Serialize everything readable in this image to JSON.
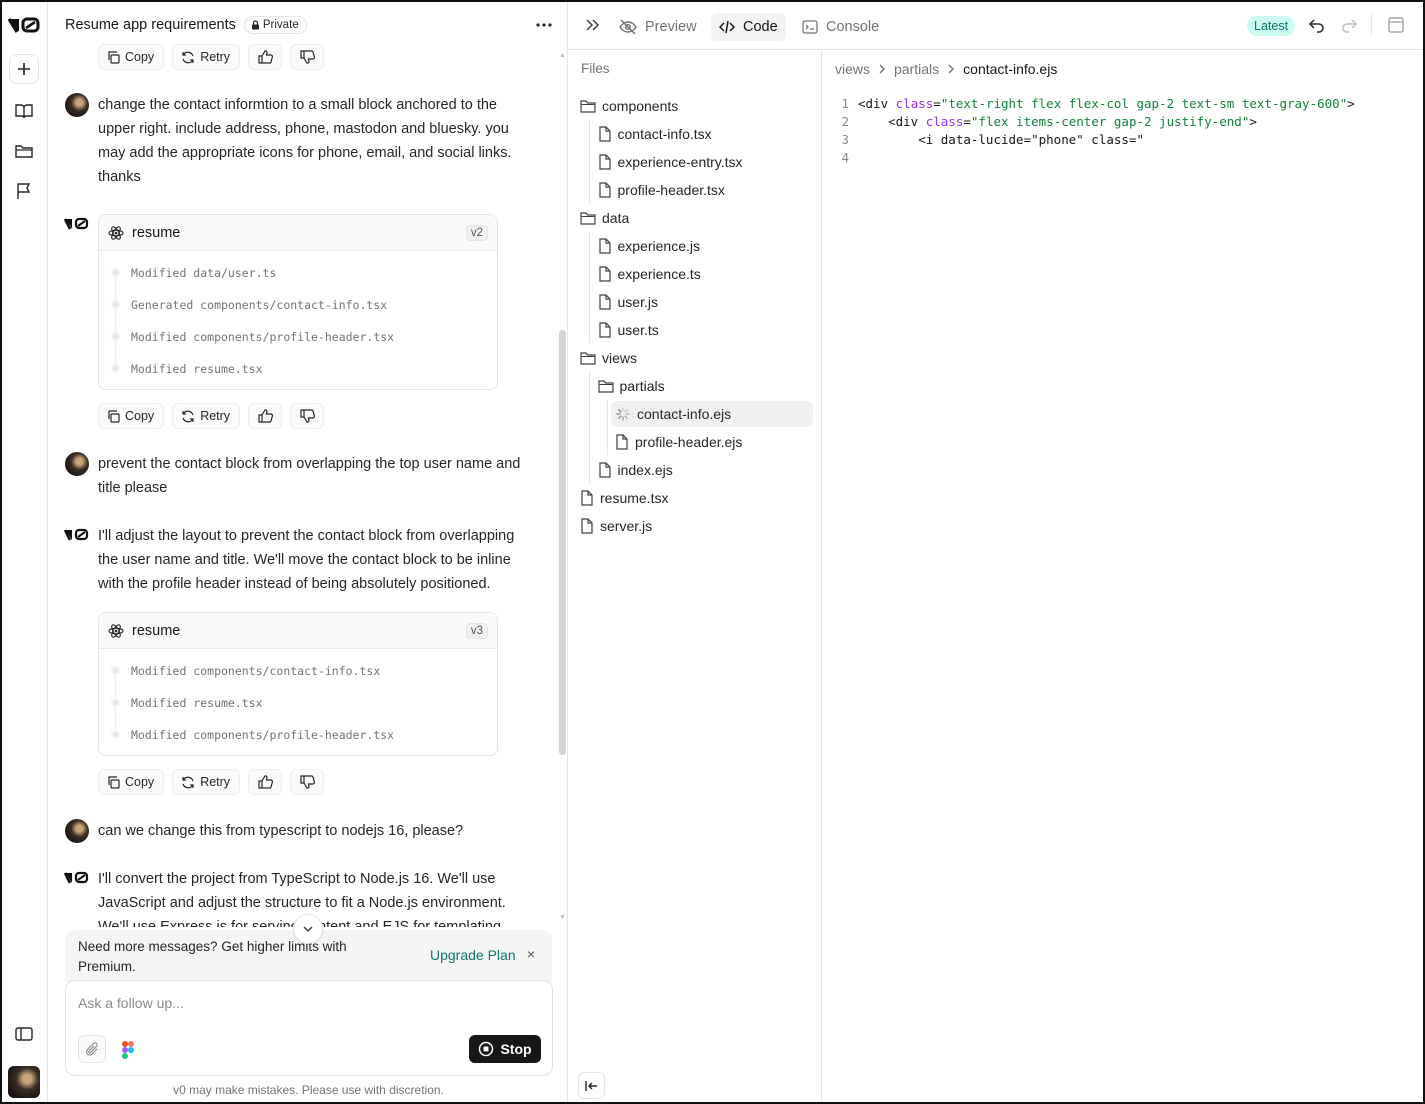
{
  "chat": {
    "title": "Resume app requirements",
    "private_label": "Private",
    "actions": {
      "copy": "Copy",
      "retry": "Retry"
    },
    "messages": [
      {
        "role": "user",
        "text": "change the contact informtion to a small block anchored to the upper right. include address, phone, mastodon and bluesky. you may add the appropriate icons for phone, email, and social links. thanks"
      },
      {
        "role": "assistant",
        "card": {
          "title": "resume",
          "version": "v2",
          "steps": [
            "Modified data/user.ts",
            "Generated components/contact-info.tsx",
            "Modified components/profile-header.tsx",
            "Modified resume.tsx"
          ]
        }
      },
      {
        "role": "user",
        "text": "prevent the contact block from overlapping the top user name and title please"
      },
      {
        "role": "assistant",
        "text": "I'll adjust the layout to prevent the contact block from overlapping the user name and title. We'll move the contact block to be inline with the profile header instead of being absolutely positioned.",
        "card": {
          "title": "resume",
          "version": "v3",
          "steps": [
            "Modified components/contact-info.tsx",
            "Modified resume.tsx",
            "Modified components/profile-header.tsx"
          ]
        }
      },
      {
        "role": "user",
        "text": "can we change this from typescript to nodejs 16, please?"
      },
      {
        "role": "assistant",
        "text": "I'll convert the project from TypeScript to Node.js 16. We'll use JavaScript and adjust the structure to fit a Node.js environment. We'll use Express.js for serving content and EJS for templating."
      }
    ],
    "upgrade": {
      "text": "Need more messages? Get higher limits with Premium.",
      "link": "Upgrade Plan",
      "close": "×"
    },
    "composer": {
      "placeholder": "Ask a follow up...",
      "stop_label": "Stop"
    },
    "disclaimer": "v0 may make mistakes. Please use with discretion."
  },
  "toolbar": {
    "tabs": [
      {
        "label": "Preview",
        "icon": "eye-off-icon",
        "active": false
      },
      {
        "label": "Code",
        "icon": "code-icon",
        "active": true
      },
      {
        "label": "Console",
        "icon": "terminal-icon",
        "active": false
      }
    ],
    "latest_label": "Latest"
  },
  "files": {
    "title": "Files",
    "tree": [
      {
        "name": "components",
        "type": "folder",
        "depth": 0
      },
      {
        "name": "contact-info.tsx",
        "type": "file",
        "depth": 1
      },
      {
        "name": "experience-entry.tsx",
        "type": "file",
        "depth": 1
      },
      {
        "name": "profile-header.tsx",
        "type": "file",
        "depth": 1
      },
      {
        "name": "data",
        "type": "folder",
        "depth": 0
      },
      {
        "name": "experience.js",
        "type": "file",
        "depth": 1
      },
      {
        "name": "experience.ts",
        "type": "file",
        "depth": 1
      },
      {
        "name": "user.js",
        "type": "file",
        "depth": 1
      },
      {
        "name": "user.ts",
        "type": "file",
        "depth": 1
      },
      {
        "name": "views",
        "type": "folder",
        "depth": 0
      },
      {
        "name": "partials",
        "type": "folder",
        "depth": 1
      },
      {
        "name": "contact-info.ejs",
        "type": "loading",
        "depth": 2,
        "selected": true
      },
      {
        "name": "profile-header.ejs",
        "type": "file",
        "depth": 2
      },
      {
        "name": "index.ejs",
        "type": "file",
        "depth": 1
      },
      {
        "name": "resume.tsx",
        "type": "file",
        "depth": 0
      },
      {
        "name": "server.js",
        "type": "file",
        "depth": 0
      }
    ]
  },
  "editor": {
    "breadcrumb": [
      "views",
      "partials",
      "contact-info.ejs"
    ],
    "lines": [
      {
        "n": "1",
        "tokens": [
          {
            "t": "tag",
            "v": "<div "
          },
          {
            "t": "attr",
            "v": "class"
          },
          {
            "t": "tag",
            "v": "="
          },
          {
            "t": "str",
            "v": "\"text-right flex flex-col gap-2 text-sm text-gray-600\""
          },
          {
            "t": "tag",
            "v": ">"
          }
        ]
      },
      {
        "n": "2",
        "tokens": [
          {
            "t": "tag",
            "v": "    <div "
          },
          {
            "t": "attr",
            "v": "class"
          },
          {
            "t": "tag",
            "v": "="
          },
          {
            "t": "str",
            "v": "\"flex items-center gap-2 justify-end\""
          },
          {
            "t": "tag",
            "v": ">"
          }
        ]
      },
      {
        "n": "3",
        "tokens": [
          {
            "t": "tag",
            "v": "        <i data-lucide=\"phone\" class=\""
          }
        ]
      },
      {
        "n": "4",
        "tokens": []
      }
    ]
  }
}
